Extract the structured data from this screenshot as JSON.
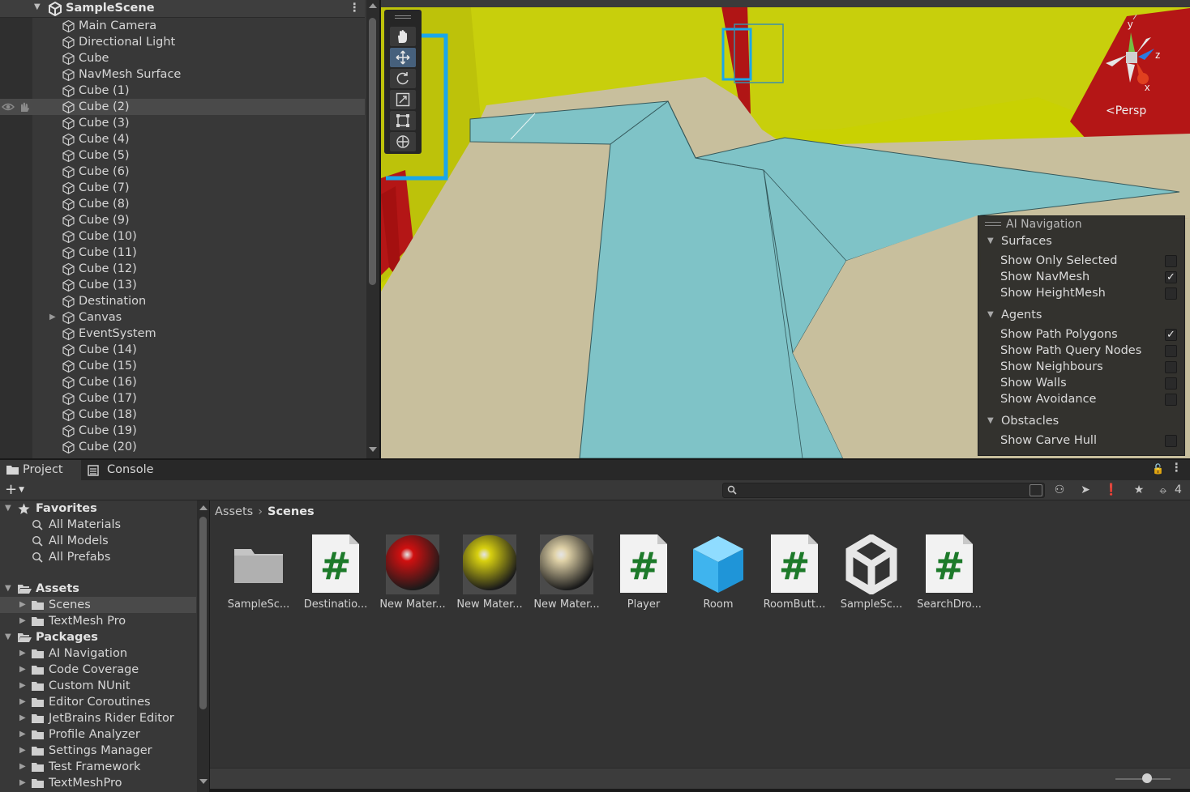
{
  "hierarchy": {
    "scene_name": "SampleScene",
    "items": [
      "Main Camera",
      "Directional Light",
      "Cube",
      "NavMesh Surface",
      "Cube (1)",
      "Cube (2)",
      "Cube (3)",
      "Cube (4)",
      "Cube (5)",
      "Cube (6)",
      "Cube (7)",
      "Cube (8)",
      "Cube (9)",
      "Cube (10)",
      "Cube (11)",
      "Cube (12)",
      "Cube (13)",
      "Destination",
      "Canvas",
      "EventSystem",
      "Cube (14)",
      "Cube (15)",
      "Cube (16)",
      "Cube (17)",
      "Cube (18)",
      "Cube (19)",
      "Cube (20)"
    ],
    "selected_item": "Cube (2)",
    "icons": {
      "scene": "unity-icon",
      "gameobject": "cube-icon",
      "visibility": "eye-icon",
      "pickable": "hand-icon",
      "menu": "kebab-icon"
    }
  },
  "scene_view": {
    "tools": [
      "hand-tool",
      "move-tool",
      "rotate-tool",
      "scale-tool",
      "rect-tool",
      "transform-tool"
    ],
    "active_tool": "move-tool",
    "gizmo": {
      "y": "y",
      "z": "z",
      "x": "x",
      "projection": "Persp"
    },
    "colors": {
      "navmesh": "#7fc2c6",
      "floor": "#c7bd9b",
      "wall": "#c6cf10",
      "red_wall": "#b01515",
      "selection": "#18a8e8"
    },
    "ai_navigation": {
      "title": "AI Navigation",
      "sections": [
        {
          "label": "Surfaces",
          "items": [
            {
              "label": "Show Only Selected",
              "checked": false
            },
            {
              "label": "Show NavMesh",
              "checked": true
            },
            {
              "label": "Show HeightMesh",
              "checked": false
            }
          ]
        },
        {
          "label": "Agents",
          "items": [
            {
              "label": "Show Path Polygons",
              "checked": true
            },
            {
              "label": "Show Path Query Nodes",
              "checked": false
            },
            {
              "label": "Show Neighbours",
              "checked": false
            },
            {
              "label": "Show Walls",
              "checked": false
            },
            {
              "label": "Show Avoidance",
              "checked": false
            }
          ]
        },
        {
          "label": "Obstacles",
          "items": [
            {
              "label": "Show Carve Hull",
              "checked": false
            }
          ]
        }
      ]
    }
  },
  "bottom": {
    "tabs": {
      "project": "Project",
      "console": "Console"
    },
    "toolbar": {
      "hidden_packages_count": "4",
      "search_placeholder": ""
    },
    "tree": {
      "favorites": {
        "label": "Favorites",
        "items": [
          "All Materials",
          "All Models",
          "All Prefabs"
        ]
      },
      "assets": {
        "label": "Assets",
        "items": [
          "Scenes",
          "TextMesh Pro"
        ]
      },
      "packages": {
        "label": "Packages",
        "items": [
          "AI Navigation",
          "Code Coverage",
          "Custom NUnit",
          "Editor Coroutines",
          "JetBrains Rider Editor",
          "Profile Analyzer",
          "Settings Manager",
          "Test Framework",
          "TextMeshPro"
        ]
      }
    },
    "breadcrumb": {
      "root": "Assets",
      "current": "Scenes"
    },
    "assets": [
      {
        "name": "SampleSc...",
        "kind": "folder"
      },
      {
        "name": "Destinatio...",
        "kind": "script"
      },
      {
        "name": "New Mater...",
        "kind": "material",
        "color": "#d01010"
      },
      {
        "name": "New Mater...",
        "kind": "material",
        "color": "#d8d010"
      },
      {
        "name": "New Mater...",
        "kind": "material",
        "color": "#e0d2a8"
      },
      {
        "name": "Player",
        "kind": "script"
      },
      {
        "name": "Room",
        "kind": "prefab"
      },
      {
        "name": "RoomButt...",
        "kind": "script"
      },
      {
        "name": "SampleSc...",
        "kind": "scene"
      },
      {
        "name": "SearchDro...",
        "kind": "script"
      }
    ]
  }
}
